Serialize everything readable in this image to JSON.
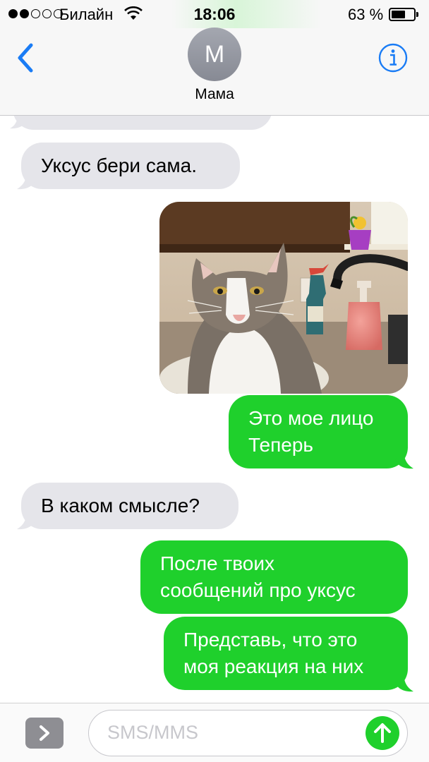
{
  "status_bar": {
    "signal_dots_filled": 2,
    "signal_dots_total": 5,
    "carrier": "Билайн",
    "time": "18:06",
    "battery_percent_text": "63 %",
    "battery_level": 0.63
  },
  "header": {
    "back_icon": "chevron-left-icon",
    "avatar_initial": "М",
    "contact_name": "Мама",
    "info_icon": "info-icon"
  },
  "messages": [
    {
      "direction": "incoming",
      "text": "Уксус бери сама."
    },
    {
      "direction": "outgoing",
      "type": "photo",
      "description_icon": "cat-photo"
    },
    {
      "direction": "outgoing",
      "lines": [
        "Это мое лицо",
        "Теперь"
      ]
    },
    {
      "direction": "incoming",
      "text": "В каком смысле?"
    },
    {
      "direction": "outgoing",
      "lines": [
        "После твоих",
        "сообщений про уксус"
      ]
    },
    {
      "direction": "outgoing",
      "lines": [
        "Представь, что это",
        "моя реакция на них"
      ]
    }
  ],
  "input_bar": {
    "expand_icon": "chevron-right-icon",
    "placeholder": "SMS/MMS",
    "send_icon": "arrow-up-icon"
  },
  "colors": {
    "outgoing_bubble": "#1fd02c",
    "incoming_bubble": "#e5e5ea",
    "accent": "#1a7cf5"
  }
}
